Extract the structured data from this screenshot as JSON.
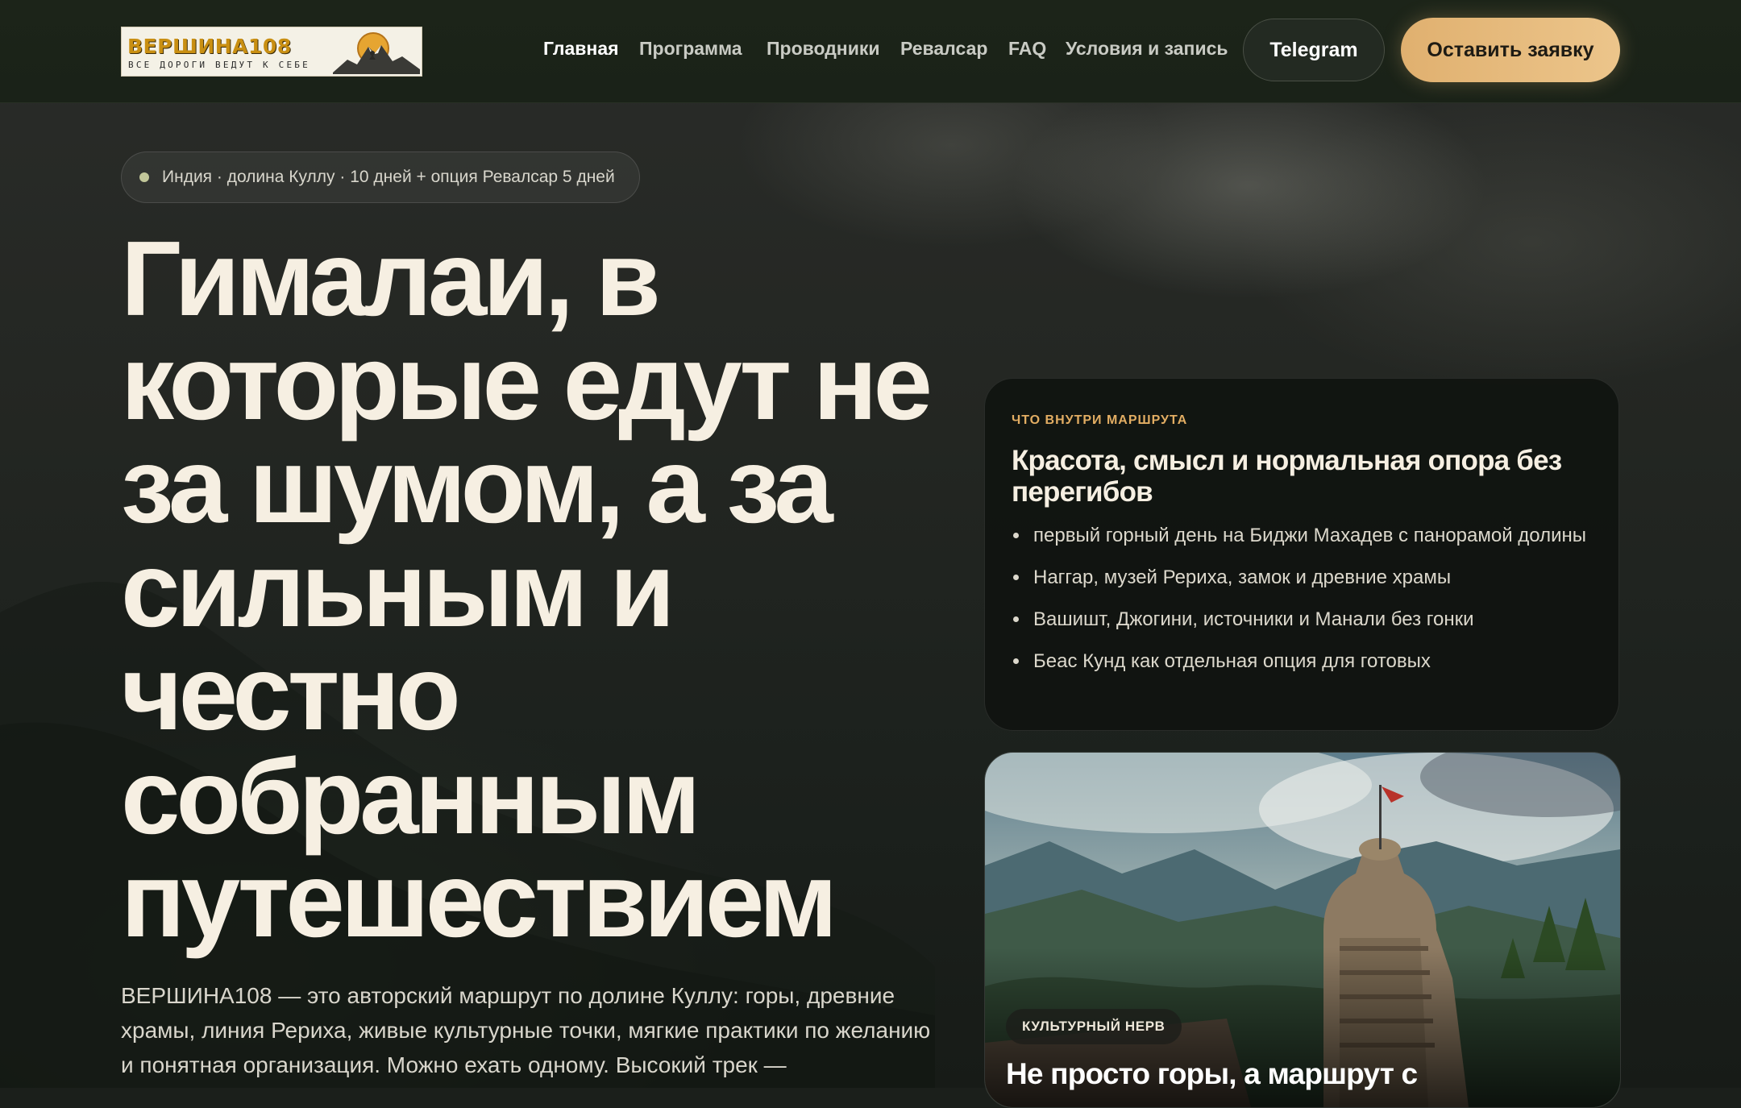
{
  "brand": {
    "logo_title": "ВЕРШИНА108",
    "logo_tagline": "ВСЕ ДОРОГИ ВЕДУТ К СЕБЕ"
  },
  "nav": {
    "items": [
      {
        "label": "Главная",
        "active": true
      },
      {
        "label": "Программа",
        "active": false
      },
      {
        "label": "Проводники",
        "active": false
      },
      {
        "label": "Ревалсар",
        "active": false
      },
      {
        "label": "FAQ",
        "active": false
      },
      {
        "label": "Условия и запись",
        "active": false
      }
    ],
    "telegram_label": "Telegram",
    "cta_label": "Оставить заявку"
  },
  "hero": {
    "chip": "Индия · долина Куллу · 10 дней + опция Ревалсар 5 дней",
    "title": "Гималаи, в которые едут не за шумом, а за сильным и честно собранным путешествием",
    "text": "ВЕРШИНА108 — это авторский маршрут по долине Куллу: горы, древние храмы, линия Рериха, живые культурные точки, мягкие практики по желанию и понятная организация. Можно ехать одному. Высокий трек —"
  },
  "route_card": {
    "kicker": "ЧТО ВНУТРИ МАРШРУТА",
    "title": "Красота, смысл и нормальная опора без перегибов",
    "items": [
      "первый горный день на Биджи Махадев с панорамой долины",
      "Наггар, музей Рериха, замок и древние храмы",
      "Вашишт, Джогини, источники и Манали без гонки",
      "Беас Кунд как отдельная опция для готовых"
    ]
  },
  "photo_card": {
    "tag": "КУЛЬТУРНЫЙ НЕРВ",
    "title": "Не просто горы, а маршрут с"
  },
  "colors": {
    "accent": "#e2ad63",
    "cta": "#ecc58b",
    "header_bg": "#1c2419",
    "text_light": "#f6efe2"
  }
}
